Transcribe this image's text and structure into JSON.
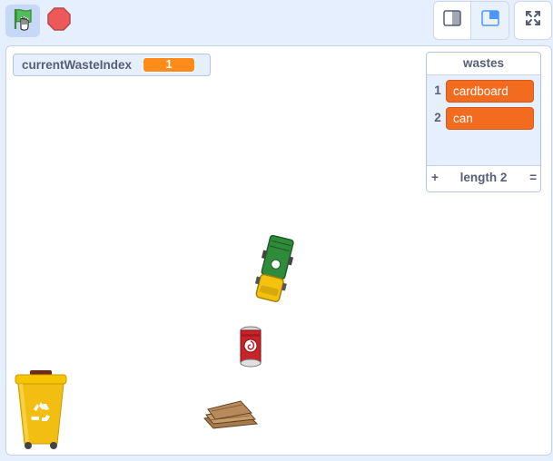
{
  "toolbar": {
    "green_flag_icon": "green-flag-icon",
    "stop_icon": "stop-sign-icon",
    "small_stage_icon": "small-stage-icon",
    "normal_stage_icon": "normal-stage-icon",
    "fullscreen_icon": "fullscreen-icon"
  },
  "variable_monitor": {
    "name": "currentWasteIndex",
    "value": "1"
  },
  "list_monitor": {
    "title": "wastes",
    "items": [
      {
        "index": "1",
        "value": "cardboard"
      },
      {
        "index": "2",
        "value": "can"
      }
    ],
    "add_label": "+",
    "length_label": "length 2",
    "resize_label": "="
  },
  "sprites": [
    "green-truck",
    "soda-can",
    "cardboard-stack",
    "yellow-recycle-bin"
  ],
  "colors": {
    "accent": "#4c97ff",
    "monitor_value": "#ff8c1a",
    "list_item": "#f26b1f",
    "stage_background": "#ffffff",
    "panel_background": "#e6effd"
  }
}
